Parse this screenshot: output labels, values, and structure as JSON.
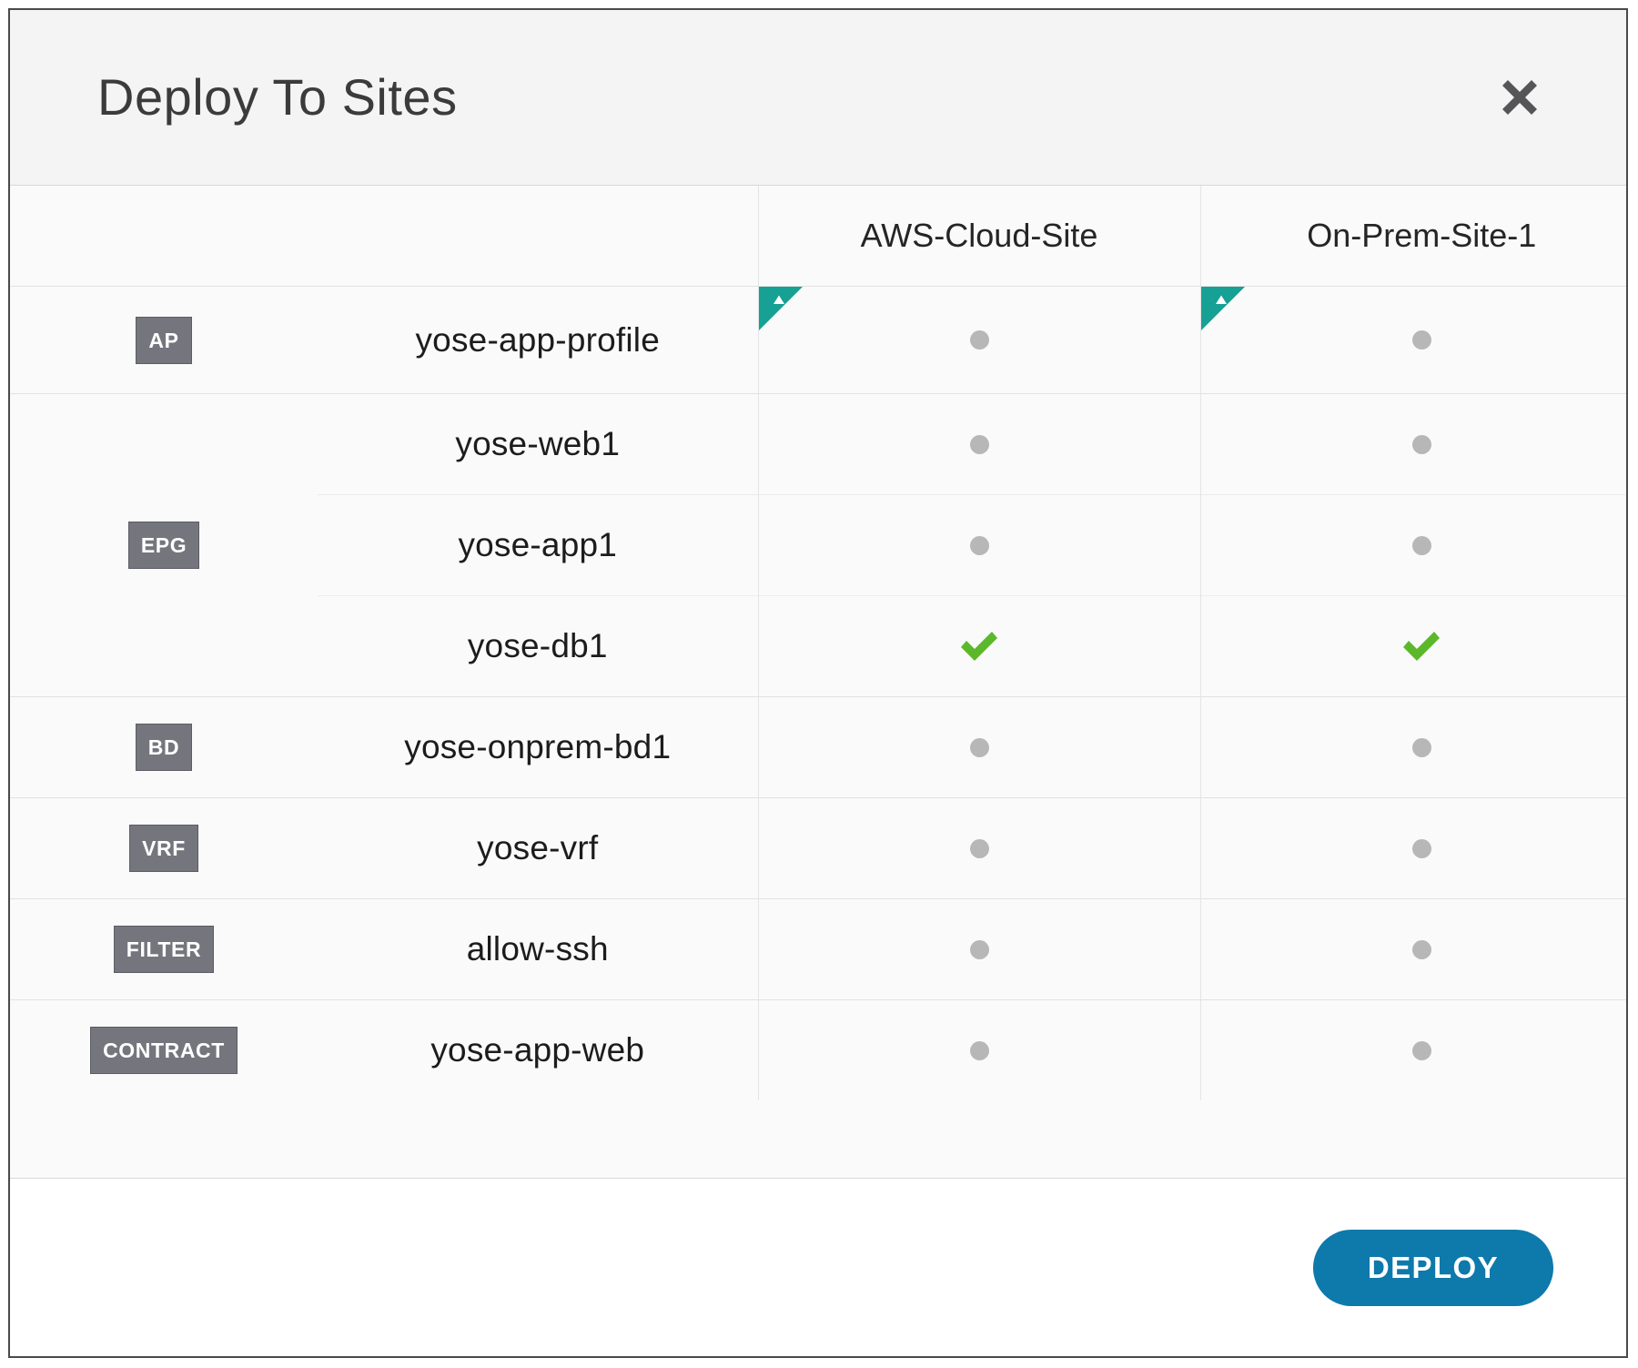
{
  "dialog": {
    "title": "Deploy To Sites",
    "close_icon": "close-icon"
  },
  "colors": {
    "accent_teal": "#17a094",
    "accent_green": "#5cb82b",
    "badge_gray": "#75757e",
    "dot_gray": "#b7b7b7",
    "deploy_blue": "#0e79ab",
    "header_bg": "#f4f4f4",
    "table_bg": "#fafafa"
  },
  "table": {
    "headers": {
      "badge_col": "",
      "name_col": "",
      "sites": [
        "AWS-Cloud-Site",
        "On-Prem-Site-1"
      ]
    },
    "rows": [
      {
        "badge": "AP",
        "name": "yose-app-profile",
        "is_sub": false,
        "badge_rowspan": 1,
        "cells": [
          {
            "state": "pending",
            "icon": "gray-dot-icon",
            "flag": "new-object-flag-icon"
          },
          {
            "state": "pending",
            "icon": "gray-dot-icon",
            "flag": "new-object-flag-icon"
          }
        ]
      },
      {
        "badge": "EPG",
        "name": "yose-web1",
        "is_sub": false,
        "badge_rowspan": 3,
        "cells": [
          {
            "state": "pending",
            "icon": "gray-dot-icon",
            "flag": null
          },
          {
            "state": "pending",
            "icon": "gray-dot-icon",
            "flag": null
          }
        ]
      },
      {
        "badge": null,
        "name": "yose-app1",
        "is_sub": true,
        "badge_rowspan": 0,
        "cells": [
          {
            "state": "pending",
            "icon": "gray-dot-icon",
            "flag": null
          },
          {
            "state": "pending",
            "icon": "gray-dot-icon",
            "flag": null
          }
        ]
      },
      {
        "badge": null,
        "name": "yose-db1",
        "is_sub": true,
        "badge_rowspan": 0,
        "cells": [
          {
            "state": "deployed",
            "icon": "green-check-icon",
            "flag": null
          },
          {
            "state": "deployed",
            "icon": "green-check-icon",
            "flag": null
          }
        ]
      },
      {
        "badge": "BD",
        "name": "yose-onprem-bd1",
        "is_sub": false,
        "badge_rowspan": 1,
        "cells": [
          {
            "state": "pending",
            "icon": "gray-dot-icon",
            "flag": null
          },
          {
            "state": "pending",
            "icon": "gray-dot-icon",
            "flag": null
          }
        ]
      },
      {
        "badge": "VRF",
        "name": "yose-vrf",
        "is_sub": false,
        "badge_rowspan": 1,
        "cells": [
          {
            "state": "pending",
            "icon": "gray-dot-icon",
            "flag": null
          },
          {
            "state": "pending",
            "icon": "gray-dot-icon",
            "flag": null
          }
        ]
      },
      {
        "badge": "FILTER",
        "name": "allow-ssh",
        "is_sub": false,
        "badge_rowspan": 1,
        "cells": [
          {
            "state": "pending",
            "icon": "gray-dot-icon",
            "flag": null
          },
          {
            "state": "pending",
            "icon": "gray-dot-icon",
            "flag": null
          }
        ]
      },
      {
        "badge": "CONTRACT",
        "name": "yose-app-web",
        "is_sub": false,
        "badge_rowspan": 1,
        "cells": [
          {
            "state": "pending",
            "icon": "gray-dot-icon",
            "flag": null
          },
          {
            "state": "pending",
            "icon": "gray-dot-icon",
            "flag": null
          }
        ]
      }
    ]
  },
  "footer": {
    "deploy_label": "DEPLOY"
  }
}
